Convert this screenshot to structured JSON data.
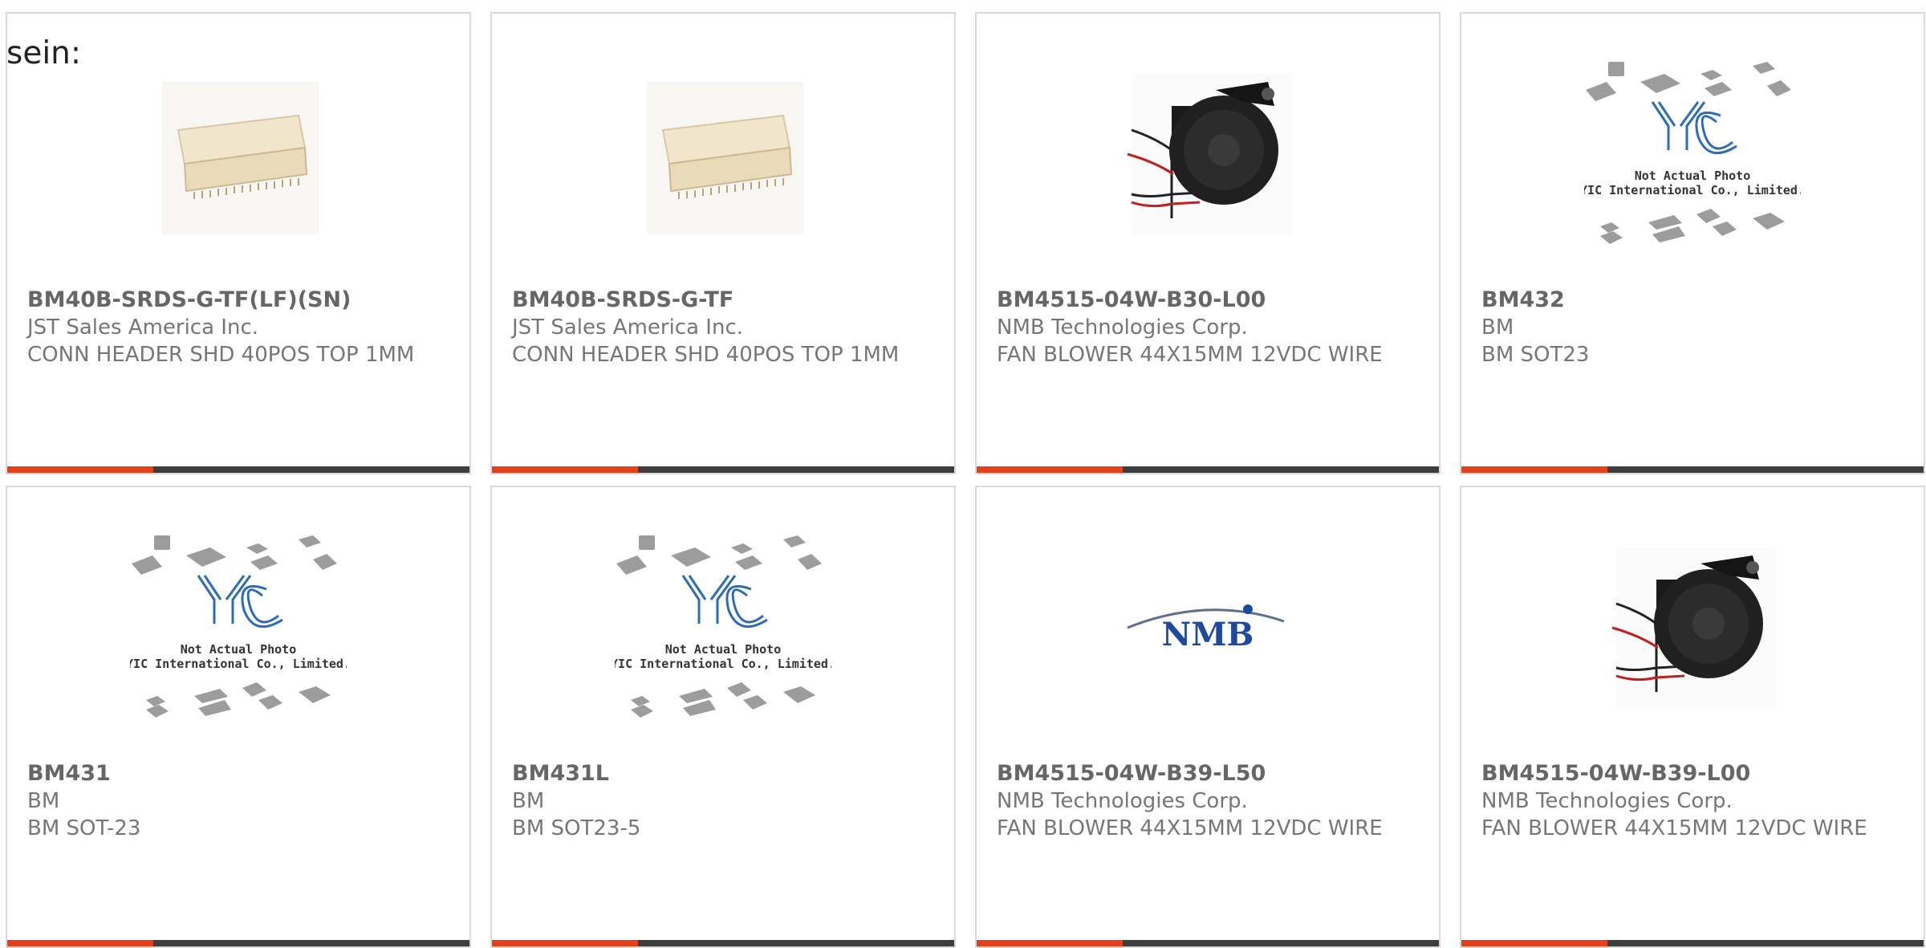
{
  "lead_text": "sein:",
  "colors": {
    "accent": "#e5401b",
    "bar": "#3d3d3d",
    "border": "#d9d9d9",
    "text": "#767676"
  },
  "cards": [
    {
      "part": "BM40B-SRDS-G-TF(LF)(SN)",
      "maker": "JST Sales America Inc.",
      "desc": "CONN HEADER SHD 40POS TOP 1MM",
      "image": "connector-photo",
      "image_text": ""
    },
    {
      "part": "BM40B-SRDS-G-TF",
      "maker": "JST Sales America Inc.",
      "desc": "CONN HEADER SHD 40POS TOP 1MM",
      "image": "connector-photo",
      "image_text": ""
    },
    {
      "part": "BM4515-04W-B30-L00",
      "maker": "NMB Technologies Corp.",
      "desc": "FAN BLOWER 44X15MM 12VDC WIRE",
      "image": "fan-blower-photo",
      "image_text": ""
    },
    {
      "part": "BM432",
      "maker": "BM",
      "desc": "BM SOT23",
      "image": "not-actual-photo-placeholder",
      "image_text": "Not Actual Photo",
      "image_text2": "YIC International Co., Limited."
    },
    {
      "part": "BM431",
      "maker": "BM",
      "desc": "BM SOT-23",
      "image": "not-actual-photo-placeholder",
      "image_text": "Not Actual Photo",
      "image_text2": "YIC International Co., Limited."
    },
    {
      "part": "BM431L",
      "maker": "BM",
      "desc": "BM SOT23-5",
      "image": "not-actual-photo-placeholder",
      "image_text": "Not Actual Photo",
      "image_text2": "YIC International Co., Limited."
    },
    {
      "part": "BM4515-04W-B39-L50",
      "maker": "NMB Technologies Corp.",
      "desc": "FAN BLOWER 44X15MM 12VDC WIRE",
      "image": "nmb-logo",
      "image_text": "NMB"
    },
    {
      "part": "BM4515-04W-B39-L00",
      "maker": "NMB Technologies Corp.",
      "desc": "FAN BLOWER 44X15MM 12VDC WIRE",
      "image": "fan-blower-photo",
      "image_text": ""
    }
  ]
}
